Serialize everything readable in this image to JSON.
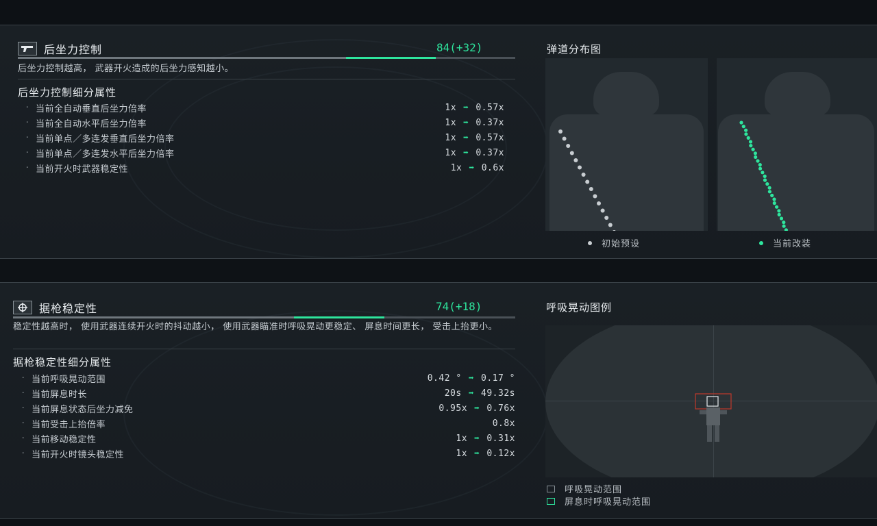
{
  "recoil": {
    "title": "后坐力控制",
    "icon": "pistol-icon",
    "score": "84(+32)",
    "bar_base": 0.66,
    "bar_current": 0.84,
    "description": "后坐力控制越高， 武器开火造成的后坐力感知越小。",
    "sub_title": "后坐力控制细分属性",
    "stats": [
      {
        "name": "当前全自动垂直后坐力倍率",
        "from": "1x",
        "to": "0.57x"
      },
      {
        "name": "当前全自动水平后坐力倍率",
        "from": "1x",
        "to": "0.37x"
      },
      {
        "name": "当前单点／多连发垂直后坐力倍率",
        "from": "1x",
        "to": "0.57x"
      },
      {
        "name": "当前单点／多连发水平后坐力倍率",
        "from": "1x",
        "to": "0.37x"
      },
      {
        "name": "当前开火时武器稳定性",
        "from": "1x",
        "to": "0.6x"
      }
    ],
    "chart_title": "弹道分布图",
    "legend_default": "初始预设",
    "legend_current": "当前改装",
    "colors": {
      "default": "#c8cdd1",
      "current": "#2ee59d"
    }
  },
  "stability": {
    "title": "据枪稳定性",
    "icon": "crosshair-icon",
    "score": "74(+18)",
    "bar_base": 0.56,
    "bar_current": 0.74,
    "description": "稳定性越高时， 使用武器连续开火时的抖动越小， 使用武器瞄准时呼吸晃动更稳定、 屏息时间更长， 受击上抬更小。",
    "sub_title": "据枪稳定性细分属性",
    "stats": [
      {
        "name": "当前呼吸晃动范围",
        "from": "0.42 °",
        "to": "0.17 °"
      },
      {
        "name": "当前屏息时长",
        "from": "20s",
        "to": "49.32s"
      },
      {
        "name": "当前屏息状态后坐力减免",
        "from": "0.95x",
        "to": "0.76x"
      },
      {
        "name": "当前受击上抬倍率",
        "from": "",
        "to": "0.8x"
      },
      {
        "name": "当前移动稳定性",
        "from": "1x",
        "to": "0.31x"
      },
      {
        "name": "当前开火时镜头稳定性",
        "from": "1x",
        "to": "0.12x"
      }
    ],
    "chart_title": "呼吸晃动图例",
    "legend_sway": "呼吸晃动范围",
    "legend_hold": "屏息时呼吸晃动范围",
    "legend_third": "···"
  },
  "accent": "#2ee59d"
}
